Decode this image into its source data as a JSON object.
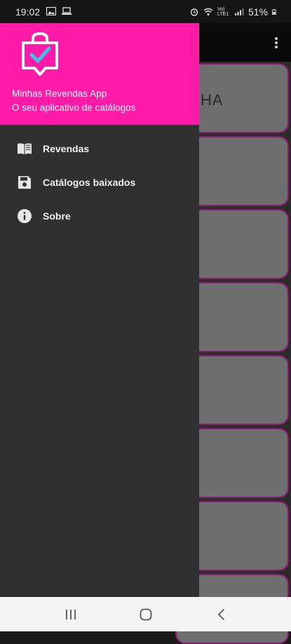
{
  "status_bar": {
    "time": "19:02",
    "network_label": "Vo) LTE1",
    "battery": "51%"
  },
  "drawer": {
    "header": {
      "app_name": "Minhas Revendas App",
      "subtitle": "O seu aplicativo de catálogos",
      "background_color": "#ff1aa8"
    },
    "items": [
      {
        "label": "Revendas",
        "icon": "book-open-icon"
      },
      {
        "label": "Catálogos baixados",
        "icon": "save-icon"
      },
      {
        "label": "Sobre",
        "icon": "info-icon"
      }
    ]
  },
  "background_content": {
    "card_partial_title": "HA"
  },
  "nav_bar": {
    "buttons": [
      "recent-apps-icon",
      "home-icon",
      "back-icon"
    ]
  }
}
